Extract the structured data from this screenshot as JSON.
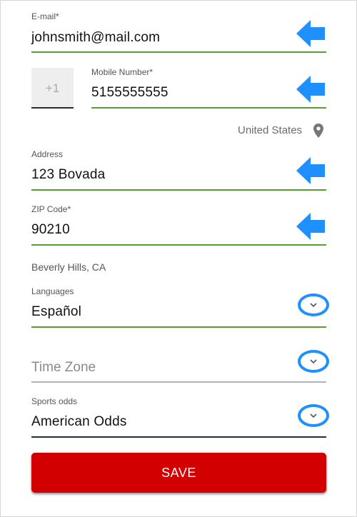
{
  "form": {
    "email": {
      "label": "E-mail*",
      "value": "johnsmith@mail.com"
    },
    "phone": {
      "country_code": "+1",
      "label": "Mobile Number*",
      "value": "5155555555"
    },
    "country": {
      "value": "United States",
      "icon": "location-pin-icon"
    },
    "address": {
      "label": "Address",
      "value": "123 Bovada"
    },
    "zip": {
      "label": "ZIP Code*",
      "value": "90210"
    },
    "city_state": "Beverly Hills, CA",
    "languages": {
      "label": "Languages",
      "value": "Español"
    },
    "time_zone": {
      "placeholder": "Time Zone"
    },
    "sports_odds": {
      "label": "Sports odds",
      "value": "American Odds"
    },
    "save_label": "SAVE"
  },
  "colors": {
    "valid_underline": "#5a9e2f",
    "highlight_arrow": "#1e90ff",
    "save_button": "#d20000"
  }
}
